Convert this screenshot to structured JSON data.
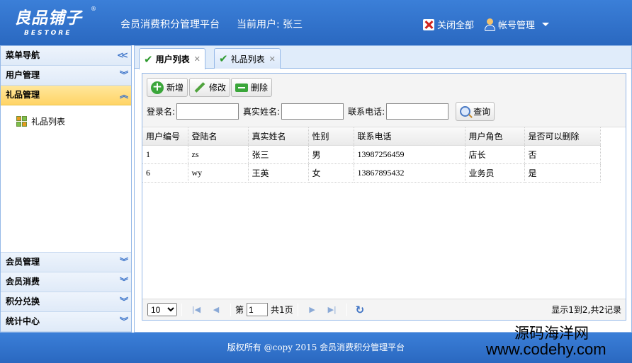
{
  "header": {
    "logo_cn": "良品铺子",
    "logo_en": "BESTORE",
    "logo_reg": "®",
    "title": "会员消费积分管理平台",
    "current_user": "当前用户: 张三",
    "close_all": "关闭全部",
    "account": "帐号管理"
  },
  "sidebar": {
    "title": "菜单导航",
    "sections": [
      {
        "label": "用户管理"
      },
      {
        "label": "礼品管理"
      },
      {
        "label": "会员管理"
      },
      {
        "label": "会员消费"
      },
      {
        "label": "积分兑换"
      },
      {
        "label": "统计中心"
      }
    ],
    "tree_items": [
      {
        "label": "礼品列表"
      }
    ]
  },
  "tabs": [
    {
      "label": "用户列表",
      "active": true
    },
    {
      "label": "礼品列表",
      "active": false
    }
  ],
  "toolbar": {
    "add": "新增",
    "edit": "修改",
    "delete": "删除"
  },
  "search": {
    "login_label": "登录名:",
    "login_value": "",
    "realname_label": "真实姓名:",
    "realname_value": "",
    "phone_label": "联系电话:",
    "phone_value": "",
    "query": "查询"
  },
  "table": {
    "columns": [
      "用户编号",
      "登陆名",
      "真实姓名",
      "性别",
      "联系电话",
      "用户角色",
      "是否可以删除"
    ],
    "rows": [
      [
        "1",
        "zs",
        "张三",
        "男",
        "13987256459",
        "店长",
        "否"
      ],
      [
        "6",
        "wy",
        "王英",
        "女",
        "13867895432",
        "业务员",
        "是"
      ]
    ]
  },
  "pager": {
    "page_size": "10",
    "page_prefix": "第",
    "page": "1",
    "page_suffix": "共1页",
    "info": "显示1到2,共2记录"
  },
  "footer": {
    "copyright": "版权所有 @copy 2015 会员消费积分管理平台"
  },
  "watermark": {
    "line1": "源码海洋网",
    "line2": "www.codehy.com"
  },
  "colors": {
    "header_blue": "#2d6fc7",
    "active_section": "#ffd466",
    "border_blue": "#95b8e7"
  }
}
